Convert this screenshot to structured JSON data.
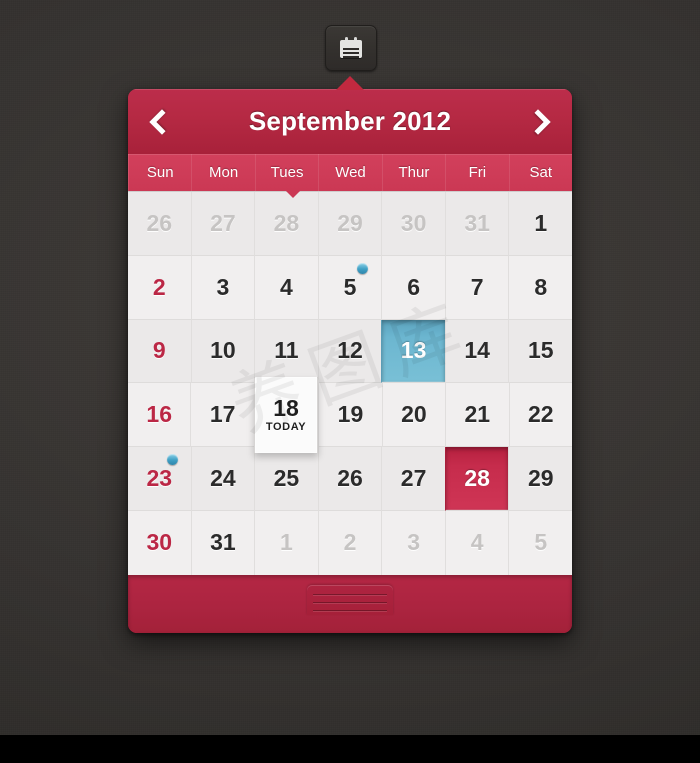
{
  "toolbar": {
    "icon_button": {
      "name": "calendar-icon",
      "tooltip": "Calendar"
    }
  },
  "header": {
    "prev_label": "‹",
    "next_label": "›",
    "title": "September 2012",
    "month": "September",
    "year": "2012"
  },
  "weekdays": [
    "Sun",
    "Mon",
    "Tues",
    "Wed",
    "Thur",
    "Fri",
    "Sat"
  ],
  "colors": {
    "brand_red": "#b42744",
    "header_red": "#b52943",
    "weekday_red": "#cb3854",
    "selected_blue": "#6cb6d0",
    "selected_red": "#c62c4c",
    "sunday_text": "#bb2745",
    "day_text": "#2b2b2b",
    "muted_text": "#c6c4c3",
    "grid_bg": "#eceaea",
    "desktop_bg": "#353230",
    "event_dot": "#3f9fc4"
  },
  "today": {
    "day": "18",
    "label": "TODAY"
  },
  "footer": {
    "grip_label": "drag-handle"
  },
  "weeks": [
    [
      {
        "day": "26",
        "state": "muted",
        "sunday": true,
        "dot": false
      },
      {
        "day": "27",
        "state": "muted",
        "sunday": false,
        "dot": false
      },
      {
        "day": "28",
        "state": "muted",
        "sunday": false,
        "dot": false
      },
      {
        "day": "29",
        "state": "muted",
        "sunday": false,
        "dot": false
      },
      {
        "day": "30",
        "state": "muted",
        "sunday": false,
        "dot": false
      },
      {
        "day": "31",
        "state": "muted",
        "sunday": false,
        "dot": false
      },
      {
        "day": "1",
        "state": "normal",
        "sunday": false,
        "dot": false
      }
    ],
    [
      {
        "day": "2",
        "state": "normal",
        "sunday": true,
        "dot": false
      },
      {
        "day": "3",
        "state": "normal",
        "sunday": false,
        "dot": false
      },
      {
        "day": "4",
        "state": "normal",
        "sunday": false,
        "dot": false
      },
      {
        "day": "5",
        "state": "normal",
        "sunday": false,
        "dot": true
      },
      {
        "day": "6",
        "state": "normal",
        "sunday": false,
        "dot": false
      },
      {
        "day": "7",
        "state": "normal",
        "sunday": false,
        "dot": false
      },
      {
        "day": "8",
        "state": "normal",
        "sunday": false,
        "dot": false
      }
    ],
    [
      {
        "day": "9",
        "state": "normal",
        "sunday": true,
        "dot": false
      },
      {
        "day": "10",
        "state": "normal",
        "sunday": false,
        "dot": false
      },
      {
        "day": "11",
        "state": "normal",
        "sunday": false,
        "dot": false
      },
      {
        "day": "12",
        "state": "normal",
        "sunday": false,
        "dot": false
      },
      {
        "day": "13",
        "state": "selected-blue",
        "sunday": false,
        "dot": false
      },
      {
        "day": "14",
        "state": "normal",
        "sunday": false,
        "dot": false
      },
      {
        "day": "15",
        "state": "normal",
        "sunday": false,
        "dot": false
      }
    ],
    [
      {
        "day": "16",
        "state": "normal",
        "sunday": true,
        "dot": false
      },
      {
        "day": "17",
        "state": "normal",
        "sunday": false,
        "dot": false
      },
      {
        "day": "18",
        "state": "today",
        "sunday": false,
        "dot": false
      },
      {
        "day": "19",
        "state": "normal",
        "sunday": false,
        "dot": false
      },
      {
        "day": "20",
        "state": "normal",
        "sunday": false,
        "dot": false
      },
      {
        "day": "21",
        "state": "normal",
        "sunday": false,
        "dot": false
      },
      {
        "day": "22",
        "state": "normal",
        "sunday": false,
        "dot": false
      }
    ],
    [
      {
        "day": "23",
        "state": "normal",
        "sunday": true,
        "dot": true
      },
      {
        "day": "24",
        "state": "normal",
        "sunday": false,
        "dot": false
      },
      {
        "day": "25",
        "state": "normal",
        "sunday": false,
        "dot": false
      },
      {
        "day": "26",
        "state": "normal",
        "sunday": false,
        "dot": false
      },
      {
        "day": "27",
        "state": "normal",
        "sunday": false,
        "dot": false
      },
      {
        "day": "28",
        "state": "selected-red",
        "sunday": false,
        "dot": false
      },
      {
        "day": "29",
        "state": "normal",
        "sunday": false,
        "dot": false
      }
    ],
    [
      {
        "day": "30",
        "state": "normal",
        "sunday": true,
        "dot": false
      },
      {
        "day": "31",
        "state": "normal",
        "sunday": false,
        "dot": false
      },
      {
        "day": "1",
        "state": "muted",
        "sunday": false,
        "dot": false
      },
      {
        "day": "2",
        "state": "muted",
        "sunday": false,
        "dot": false
      },
      {
        "day": "3",
        "state": "muted",
        "sunday": false,
        "dot": false
      },
      {
        "day": "4",
        "state": "muted",
        "sunday": false,
        "dot": false
      },
      {
        "day": "5",
        "state": "muted",
        "sunday": false,
        "dot": false
      }
    ]
  ]
}
